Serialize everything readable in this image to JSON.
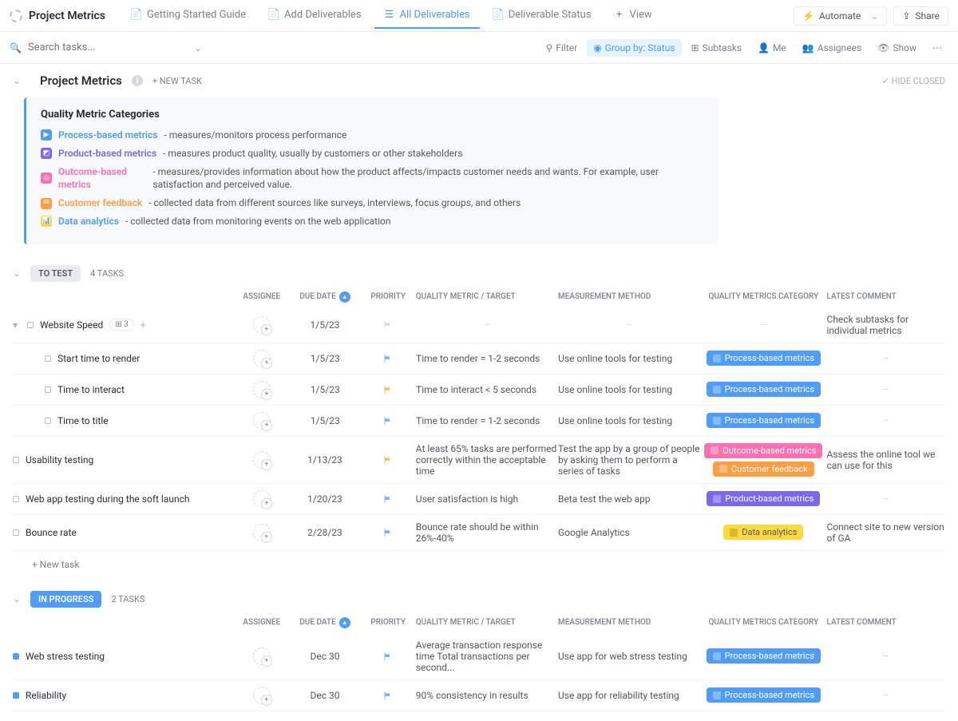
{
  "header": {
    "title": "Project Metrics",
    "tabs": [
      {
        "label": "Getting Started Guide"
      },
      {
        "label": "Add Deliverables"
      },
      {
        "label": "All Deliverables"
      },
      {
        "label": "Deliverable Status"
      },
      {
        "label": "View"
      }
    ],
    "automate": "Automate",
    "share": "Share"
  },
  "toolbar": {
    "search_placeholder": "Search tasks...",
    "filter": "Filter",
    "group_by": "Group by: Status",
    "subtasks": "Subtasks",
    "me": "Me",
    "assignees": "Assignees",
    "show": "Show"
  },
  "page": {
    "title": "Project Metrics",
    "new_task": "+ NEW TASK",
    "hide_closed": "✓ HIDE CLOSED"
  },
  "info": {
    "heading": "Quality Metric Categories",
    "items": [
      {
        "cat": "Process-based metrics",
        "desc": " - measures/monitors process performance"
      },
      {
        "cat": "Product-based metrics",
        "desc": " - measures product quality, usually by  customers or other stakeholders"
      },
      {
        "cat": "Outcome-based metrics",
        "desc": " - measures/provides information about how the product affects/impacts customer needs and wants. For example, user satisfaction and perceived value."
      },
      {
        "cat": "Customer feedback",
        "desc": " - collected data from different sources like surveys, interviews, focus groups, and others"
      },
      {
        "cat": "Data analytics",
        "desc": " - collected data from monitoring events on the web application"
      }
    ]
  },
  "columns": {
    "assignee": "ASSIGNEE",
    "due": "DUE DATE",
    "priority": "PRIORITY",
    "target": "QUALITY METRIC / TARGET",
    "method": "MEASUREMENT METHOD",
    "category": "QUALITY METRICS CATEGORY",
    "comment": "LATEST COMMENT"
  },
  "groups": [
    {
      "status": "TO TEST",
      "count": "4 TASKS",
      "rows": [
        {
          "name": "Website Speed",
          "sub": "3",
          "due": "1/5/23",
          "flag": "gray",
          "target": "–",
          "method": "–",
          "badges": [],
          "comment": "Check subtasks for individual metrics",
          "parent": true
        },
        {
          "name": "Start time to render",
          "due": "1/5/23",
          "flag": "blue",
          "target": "Time to render = 1-2 seconds",
          "method": "Use online tools for testing",
          "badges": [
            "process"
          ],
          "comment": "–",
          "child": true
        },
        {
          "name": "Time to interact",
          "due": "1/5/23",
          "flag": "yellow",
          "target": "Time to interact < 5 seconds",
          "method": "Use online tools for testing",
          "badges": [
            "process"
          ],
          "comment": "–",
          "child": true
        },
        {
          "name": "Time to title",
          "due": "1/5/23",
          "flag": "blue",
          "target": "Time to render = 1-2 seconds",
          "method": "Use online tools for testing",
          "badges": [
            "process"
          ],
          "comment": "–",
          "child": true
        },
        {
          "name": "Usability testing",
          "due": "1/13/23",
          "flag": "yellow",
          "target": "At least 65% tasks are performed correctly within the acceptable time",
          "method": "Test the app by a group of people by asking them to perform a series of tasks",
          "badges": [
            "outcome",
            "customer"
          ],
          "comment": "Assess the online tool we can use for this"
        },
        {
          "name": "Web app testing during the soft launch",
          "due": "1/20/23",
          "flag": "blue",
          "target": "User satisfaction is high",
          "method": "Beta test the web app",
          "badges": [
            "product"
          ],
          "comment": "–"
        },
        {
          "name": "Bounce rate",
          "due": "2/28/23",
          "flag": "blue",
          "target": "Bounce rate should be within 26%-40%",
          "method": "Google Analytics",
          "badges": [
            "analytics"
          ],
          "comment": "Connect site to new version of GA"
        }
      ]
    },
    {
      "status": "IN PROGRESS",
      "count": "2 TASKS",
      "rows": [
        {
          "name": "Web stress testing",
          "due": "Dec 30",
          "flag": "blue",
          "target": "Average transaction response time Total transactions per second...",
          "method": "Use app for web stress testing",
          "badges": [
            "process"
          ],
          "comment": "–",
          "blue": true
        },
        {
          "name": "Reliability",
          "due": "Dec 30",
          "flag": "blue",
          "target": "90% consistency in results",
          "method": "Use app for reliability testing",
          "badges": [
            "process"
          ],
          "comment": "–",
          "blue": true
        }
      ]
    }
  ],
  "badge_labels": {
    "process": "Process-based metrics",
    "outcome": "Outcome-based metrics",
    "customer": "Customer feedback",
    "product": "Product-based metrics",
    "analytics": "Data analytics"
  },
  "new_task_row": "+ New task"
}
